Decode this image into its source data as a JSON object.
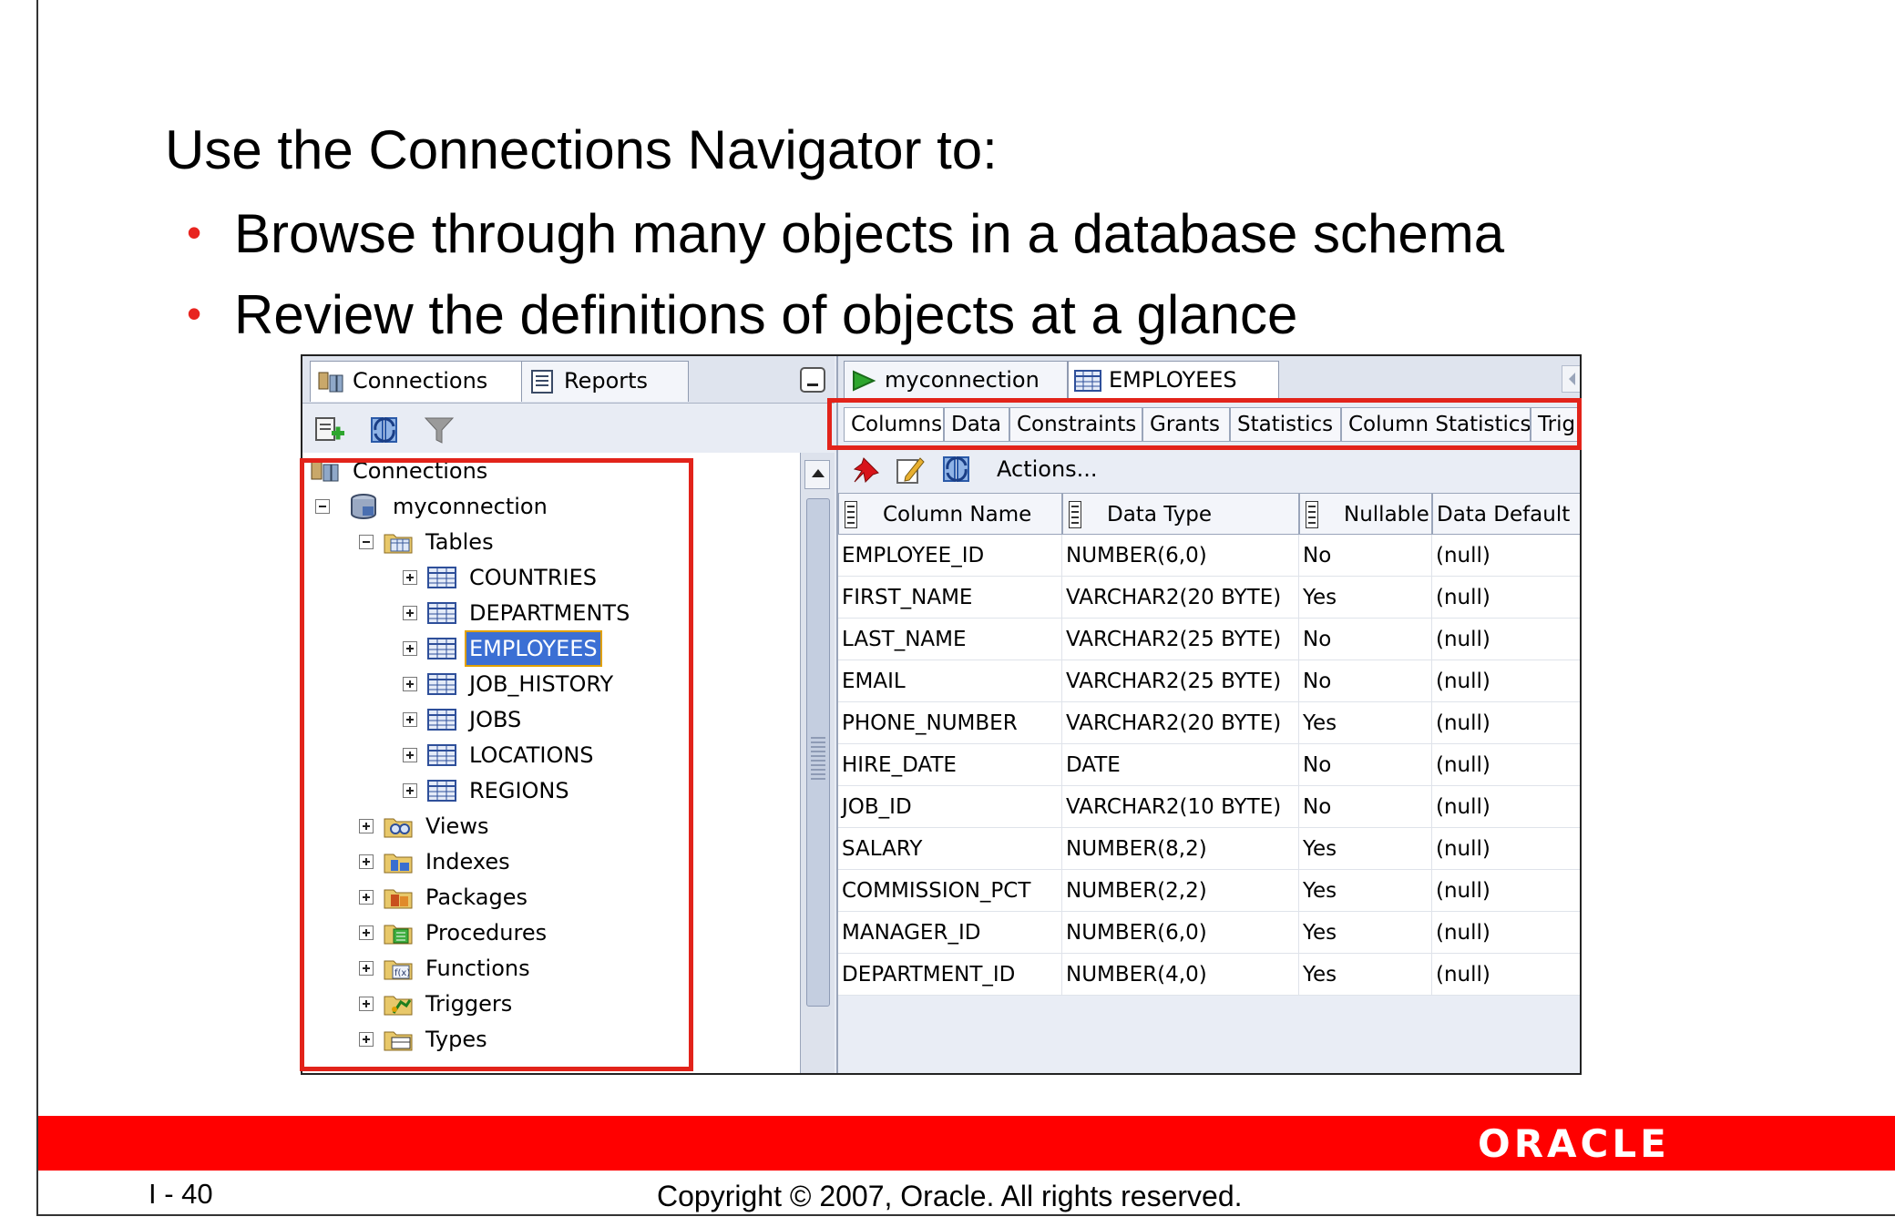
{
  "slide": {
    "heading": "Use the Connections Navigator to:",
    "bullets": [
      "Browse through many objects in a database schema",
      "Review the definitions of objects at a glance"
    ],
    "page_number": "I - 40",
    "copyright": "Copyright © 2007, Oracle. All rights reserved.",
    "logo_text": "ORACLE",
    "colors": {
      "brand_red": "#ff0000",
      "highlight_red": "#e2231a",
      "bullet_red": "#e8241f"
    }
  },
  "navigator": {
    "tabs": [
      {
        "label": "Connections",
        "icon": "connections-icon"
      },
      {
        "label": "Reports",
        "icon": "reports-icon"
      }
    ],
    "toolbar_icons": [
      "add-connection-icon",
      "refresh-icon",
      "filter-icon"
    ],
    "tree": {
      "root": "Connections",
      "connection": "myconnection",
      "tables_folder": "Tables",
      "tables": [
        "COUNTRIES",
        "DEPARTMENTS",
        "EMPLOYEES",
        "JOB_HISTORY",
        "JOBS",
        "LOCATIONS",
        "REGIONS"
      ],
      "selected_table": "EMPLOYEES",
      "folders": [
        "Views",
        "Indexes",
        "Packages",
        "Procedures",
        "Functions",
        "Triggers",
        "Types"
      ]
    }
  },
  "editor": {
    "tabs": [
      {
        "label": "myconnection",
        "icon": "sql-worksheet-icon"
      },
      {
        "label": "EMPLOYEES",
        "icon": "table-icon"
      }
    ],
    "subtabs": [
      "Columns",
      "Data",
      "Constraints",
      "Grants",
      "Statistics",
      "Column Statistics",
      "Trig"
    ],
    "active_subtab": "Columns",
    "toolbar": {
      "actions_label": "Actions...",
      "icons": [
        "pin-icon",
        "edit-icon",
        "refresh-icon"
      ]
    },
    "columns_grid": {
      "headers": [
        "Column Name",
        "Data Type",
        "Nullable",
        "Data Default"
      ],
      "rows": [
        [
          "EMPLOYEE_ID",
          "NUMBER(6,0)",
          "No",
          "(null)"
        ],
        [
          "FIRST_NAME",
          "VARCHAR2(20 BYTE)",
          "Yes",
          "(null)"
        ],
        [
          "LAST_NAME",
          "VARCHAR2(25 BYTE)",
          "No",
          "(null)"
        ],
        [
          "EMAIL",
          "VARCHAR2(25 BYTE)",
          "No",
          "(null)"
        ],
        [
          "PHONE_NUMBER",
          "VARCHAR2(20 BYTE)",
          "Yes",
          "(null)"
        ],
        [
          "HIRE_DATE",
          "DATE",
          "No",
          "(null)"
        ],
        [
          "JOB_ID",
          "VARCHAR2(10 BYTE)",
          "No",
          "(null)"
        ],
        [
          "SALARY",
          "NUMBER(8,2)",
          "Yes",
          "(null)"
        ],
        [
          "COMMISSION_PCT",
          "NUMBER(2,2)",
          "Yes",
          "(null)"
        ],
        [
          "MANAGER_ID",
          "NUMBER(6,0)",
          "Yes",
          "(null)"
        ],
        [
          "DEPARTMENT_ID",
          "NUMBER(4,0)",
          "Yes",
          "(null)"
        ]
      ]
    }
  }
}
